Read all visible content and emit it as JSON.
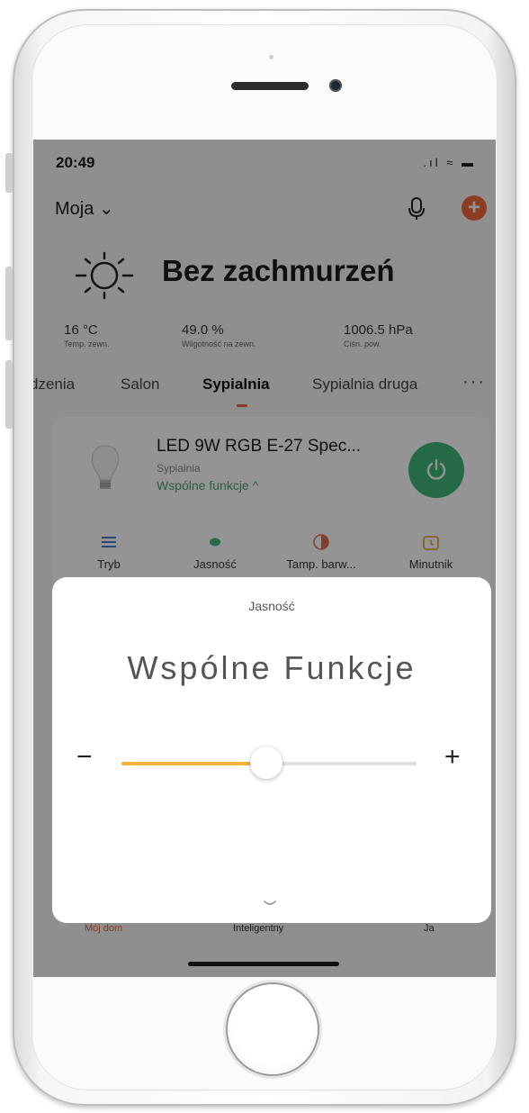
{
  "status_bar": {
    "time": "20:49",
    "icons": ".ıl ≈ ▬"
  },
  "header": {
    "home_name": "Moja ⌄"
  },
  "weather": {
    "condition": "Bez zachmurzeń",
    "stats": [
      {
        "value": "16 °C",
        "label": "Temp. zewn."
      },
      {
        "value": "49.0 %",
        "label": "Wilgotność na zewn."
      },
      {
        "value": "1006.5 hPa",
        "label": "Ciśn. pow."
      }
    ]
  },
  "room_tabs": [
    {
      "label": "dzenia"
    },
    {
      "label": "Salon"
    },
    {
      "label": "Sypialnia",
      "active": true
    },
    {
      "label": "Sypialnia druga"
    }
  ],
  "more_label": "···",
  "device": {
    "name": "LED 9W RGB E-27 Spec...",
    "room": "Sypialnia",
    "functions_link": "Wspólne funkcje ^",
    "functions": [
      {
        "label": "Tryb",
        "icon": "list-icon"
      },
      {
        "label": "Jasność",
        "icon": "brightness-dot-icon"
      },
      {
        "label": "Tamp. barw...",
        "icon": "color-temp-icon"
      },
      {
        "label": "Minutnik",
        "icon": "timer-icon"
      }
    ],
    "power_color": "#3fb77a"
  },
  "bottom_nav": [
    {
      "label": "Mój dom",
      "active": true
    },
    {
      "label": "Inteligentny"
    },
    {
      "label": "Ja"
    }
  ],
  "sheet": {
    "title": "Jasność",
    "heading": "Wspólne Funkcje",
    "minus": "−",
    "plus": "+",
    "brightness_fraction": 0.49
  },
  "colors": {
    "accent": "#e2683b",
    "slider_fill": "#f2b338",
    "link_green": "#4aa36a"
  }
}
